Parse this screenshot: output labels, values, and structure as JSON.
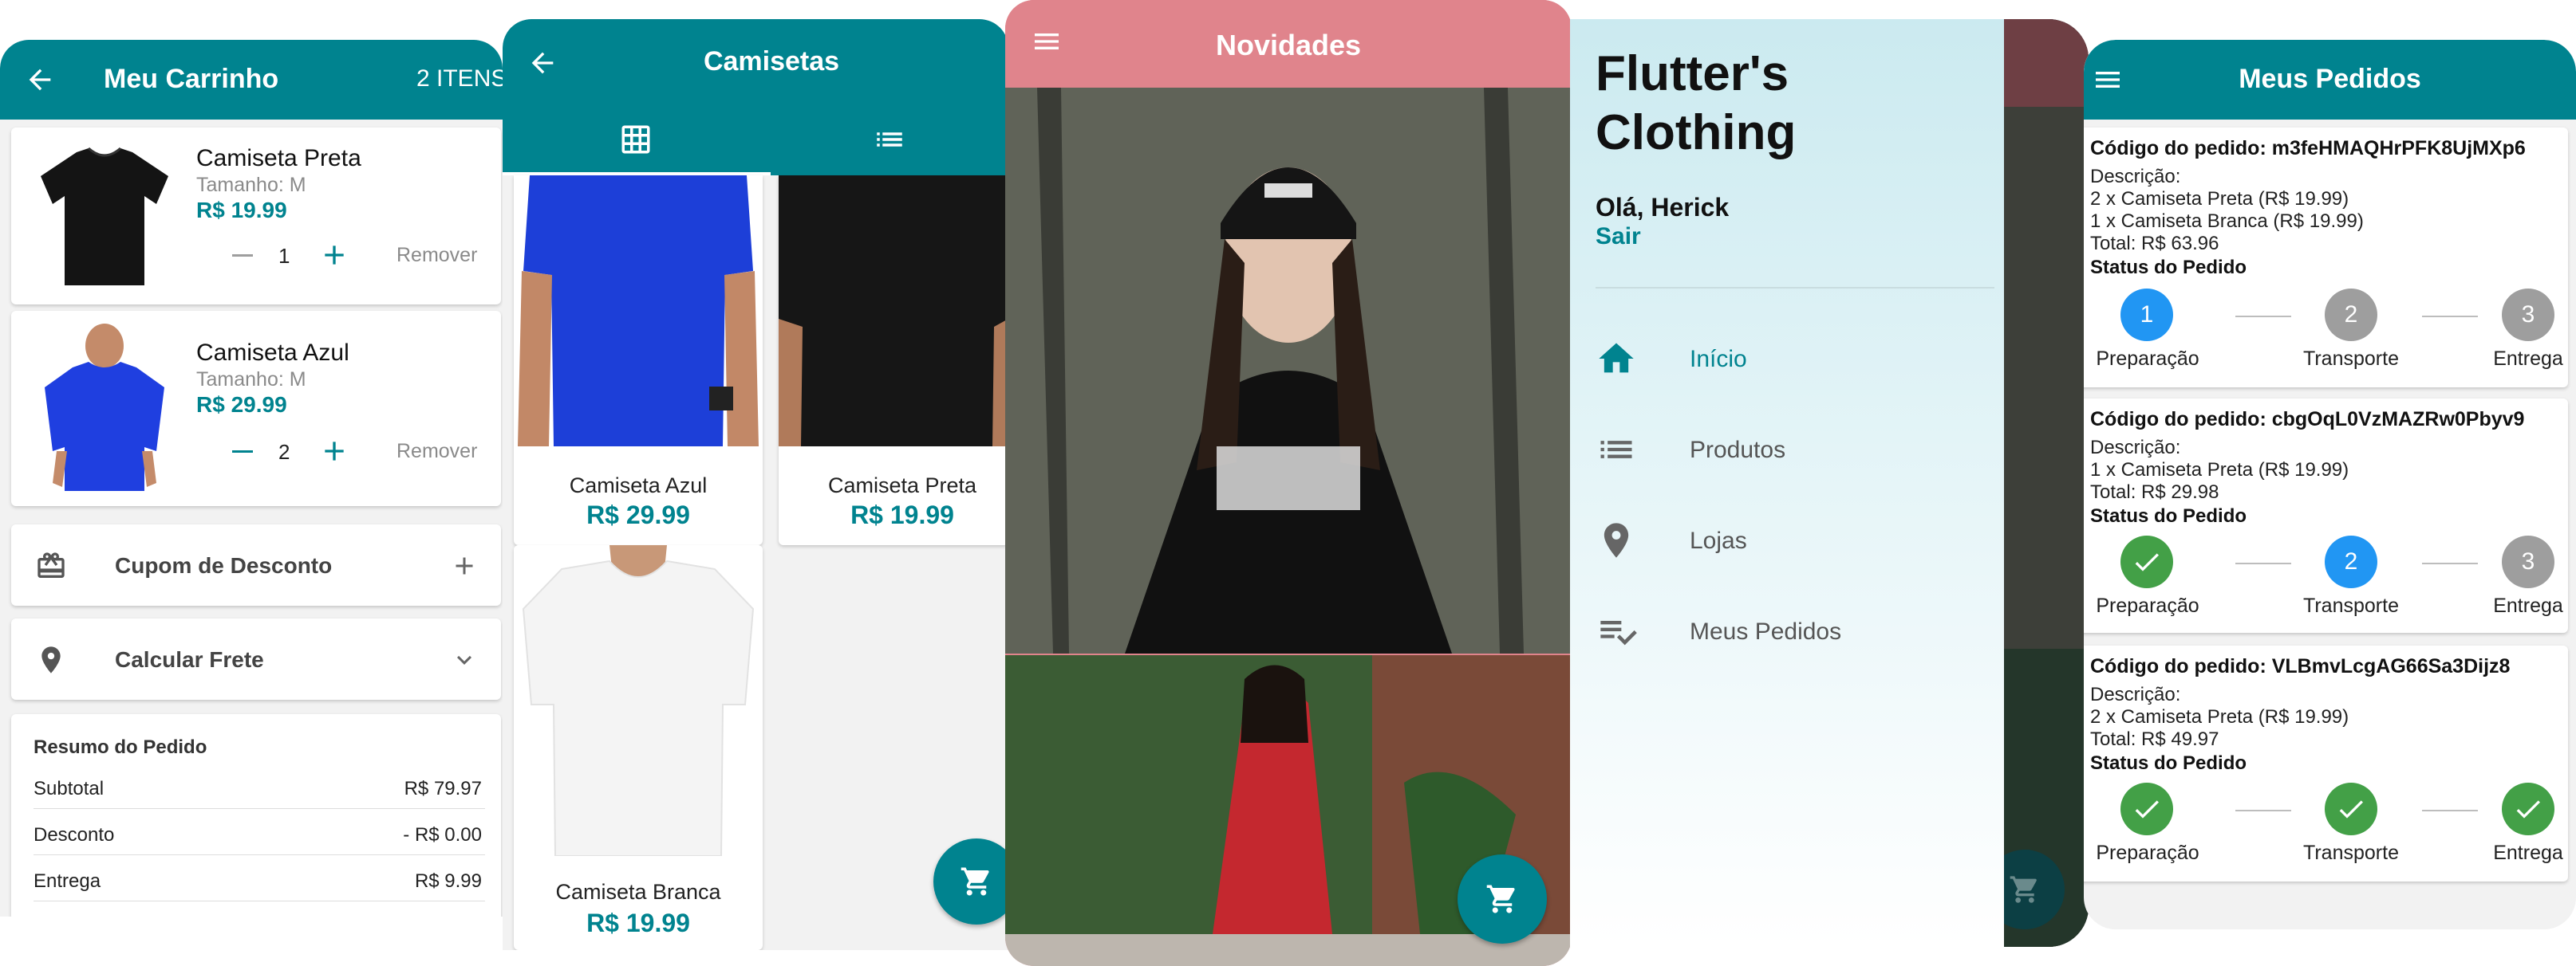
{
  "cart": {
    "title": "Meu Carrinho",
    "count": "2 ITENS",
    "items": [
      {
        "name": "Camiseta Preta",
        "size": "Tamanho: M",
        "price": "R$ 19.99",
        "qty": "1",
        "remove": "Remover"
      },
      {
        "name": "Camiseta Azul",
        "size": "Tamanho: M",
        "price": "R$ 29.99",
        "qty": "2",
        "remove": "Remover"
      }
    ],
    "coupon": "Cupom de Desconto",
    "shipping": "Calcular Frete",
    "summary": {
      "title": "Resumo do Pedido",
      "subtotal_label": "Subtotal",
      "subtotal": "R$ 79.97",
      "discount_label": "Desconto",
      "discount": "- R$ 0.00",
      "delivery_label": "Entrega",
      "delivery": "R$ 9.99"
    }
  },
  "category": {
    "title": "Camisetas",
    "products": [
      {
        "name": "Camiseta Azul",
        "price": "R$ 29.99"
      },
      {
        "name": "Camiseta Preta",
        "price": "R$ 19.99"
      },
      {
        "name": "Camiseta Branca",
        "price": "R$ 19.99"
      }
    ]
  },
  "home": {
    "title": "Novidades"
  },
  "drawer": {
    "store_name": "Flutter's Clothing",
    "greeting": "Olá, Herick",
    "logout": "Sair",
    "items": [
      {
        "label": "Início",
        "icon": "home-icon",
        "active": true
      },
      {
        "label": "Produtos",
        "icon": "list-icon",
        "active": false
      },
      {
        "label": "Lojas",
        "icon": "location-pin-icon",
        "active": false
      },
      {
        "label": "Meus Pedidos",
        "icon": "playlist-check-icon",
        "active": false
      }
    ]
  },
  "orders": {
    "title": "Meus Pedidos",
    "step_labels": [
      "Preparação",
      "Transporte",
      "Entrega"
    ],
    "status_label": "Status do Pedido",
    "description_label": "Descrição:",
    "list": [
      {
        "code": "Código do pedido: m3feHMAQHrPFK8UjMXp6",
        "lines": [
          "2 x Camiseta Preta (R$ 19.99)",
          "1 x Camiseta Branca (R$ 19.99)"
        ],
        "total": "Total: R$ 63.96",
        "states": [
          "1",
          "2",
          "3"
        ]
      },
      {
        "code": "Código do pedido: cbgOqL0VzMAZRw0Pbyv9",
        "lines": [
          "1 x Camiseta Preta (R$ 19.99)"
        ],
        "total": "Total: R$ 29.98",
        "states": [
          "done",
          "2",
          "3"
        ]
      },
      {
        "code": "Código do pedido: VLBmvLcgAG66Sa3Dijz8",
        "lines": [
          "2 x Camiseta Preta (R$ 19.99)"
        ],
        "total": "Total: R$ 49.97",
        "states": [
          "done",
          "done",
          "done"
        ]
      }
    ]
  },
  "colors": {
    "teal": "#00838f",
    "pink": "#e0848c",
    "blue": "#2196f3",
    "green": "#43a047",
    "grey": "#9e9e9e"
  }
}
